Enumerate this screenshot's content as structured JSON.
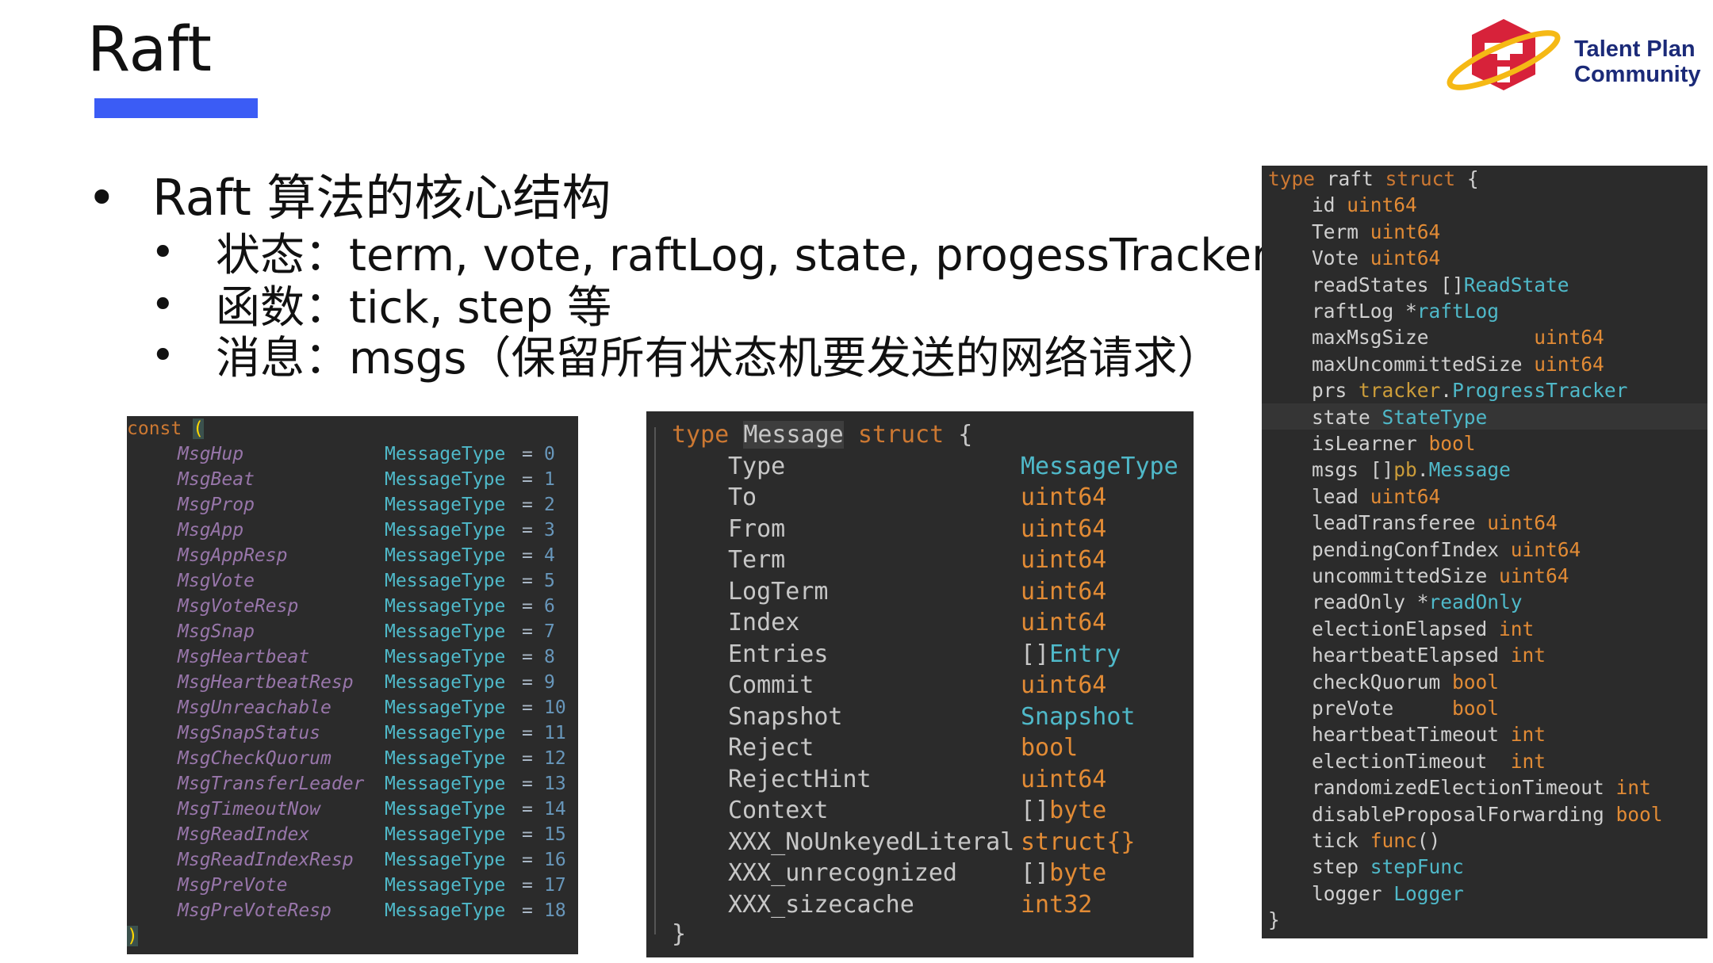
{
  "slide": {
    "title": "Raft",
    "accent_color": "#3b5cf5"
  },
  "logo": {
    "line1": "Talent Plan",
    "line2": "Community",
    "icon": "talent-plan-logo-icon"
  },
  "bullets": {
    "main": "Raft 算法的核心结构",
    "sub": [
      "状态：term, vote, raftLog, state, progessTracker 等",
      "函数：tick, step 等",
      "消息：msgs（保留所有状态机要发送的网络请求）"
    ]
  },
  "code_const": {
    "open_keyword": "const",
    "open_paren": "(",
    "close_paren": ")",
    "type_name": "MessageType",
    "entries": [
      {
        "name": "MsgHup",
        "value": "0"
      },
      {
        "name": "MsgBeat",
        "value": "1"
      },
      {
        "name": "MsgProp",
        "value": "2"
      },
      {
        "name": "MsgApp",
        "value": "3"
      },
      {
        "name": "MsgAppResp",
        "value": "4"
      },
      {
        "name": "MsgVote",
        "value": "5"
      },
      {
        "name": "MsgVoteResp",
        "value": "6"
      },
      {
        "name": "MsgSnap",
        "value": "7"
      },
      {
        "name": "MsgHeartbeat",
        "value": "8"
      },
      {
        "name": "MsgHeartbeatResp",
        "value": "9"
      },
      {
        "name": "MsgUnreachable",
        "value": "10"
      },
      {
        "name": "MsgSnapStatus",
        "value": "11"
      },
      {
        "name": "MsgCheckQuorum",
        "value": "12"
      },
      {
        "name": "MsgTransferLeader",
        "value": "13"
      },
      {
        "name": "MsgTimeoutNow",
        "value": "14"
      },
      {
        "name": "MsgReadIndex",
        "value": "15"
      },
      {
        "name": "MsgReadIndexResp",
        "value": "16"
      },
      {
        "name": "MsgPreVote",
        "value": "17"
      },
      {
        "name": "MsgPreVoteResp",
        "value": "18"
      }
    ]
  },
  "code_message": {
    "kw_type": "type",
    "name": "Message",
    "kw_struct": "struct",
    "open_brace": "{",
    "close_brace": "}",
    "fields": [
      {
        "name": "Type",
        "type": "MessageType"
      },
      {
        "name": "To",
        "type": "uint64"
      },
      {
        "name": "From",
        "type": "uint64"
      },
      {
        "name": "Term",
        "type": "uint64"
      },
      {
        "name": "LogTerm",
        "type": "uint64"
      },
      {
        "name": "Index",
        "type": "uint64"
      },
      {
        "name": "Entries",
        "type_prefix": "[]",
        "type": "Entry"
      },
      {
        "name": "Commit",
        "type": "uint64"
      },
      {
        "name": "Snapshot",
        "type": "Snapshot"
      },
      {
        "name": "Reject",
        "type": "bool"
      },
      {
        "name": "RejectHint",
        "type": "uint64"
      },
      {
        "name": "Context",
        "type_prefix": "[]",
        "type": "byte"
      },
      {
        "name": "XXX_NoUnkeyedLiteral",
        "type": "struct{}"
      },
      {
        "name": "XXX_unrecognized",
        "type_prefix": "[]",
        "type": "byte"
      },
      {
        "name": "XXX_sizecache",
        "type": "int32"
      }
    ]
  },
  "code_raft": {
    "kw_type": "type",
    "name": "raft",
    "kw_struct": "struct",
    "open_brace": "{",
    "close_brace": "}",
    "fields": [
      {
        "name": "id",
        "sep": " ",
        "pre": "",
        "type": "uint64",
        "kind": "builtin"
      },
      {
        "name": "Term",
        "sep": " ",
        "pre": "",
        "type": "uint64",
        "kind": "builtin"
      },
      {
        "name": "Vote",
        "sep": " ",
        "pre": "",
        "type": "uint64",
        "kind": "builtin"
      },
      {
        "name": "readStates",
        "sep": " ",
        "pre": "[]",
        "type": "ReadState",
        "kind": "ref"
      },
      {
        "name": "raftLog",
        "sep": " ",
        "pre": "*",
        "type": "raftLog",
        "kind": "ref"
      },
      {
        "name": "maxMsgSize",
        "sep": "         ",
        "pre": "",
        "type": "uint64",
        "kind": "builtin"
      },
      {
        "name": "maxUncommittedSize",
        "sep": " ",
        "pre": "",
        "type": "uint64",
        "kind": "builtin"
      },
      {
        "name": "prs",
        "sep": " ",
        "pre": "",
        "pkg": "tracker",
        "type": "ProgressTracker",
        "kind": "ref"
      },
      {
        "name": "state",
        "sep": " ",
        "pre": "",
        "type": "StateType",
        "kind": "ref"
      },
      {
        "name": "isLearner",
        "sep": " ",
        "pre": "",
        "type": "bool",
        "kind": "builtin"
      },
      {
        "name": "msgs",
        "sep": " ",
        "pre": "[]",
        "pkg": "pb",
        "type": "Message",
        "kind": "ref"
      },
      {
        "name": "lead",
        "sep": " ",
        "pre": "",
        "type": "uint64",
        "kind": "builtin"
      },
      {
        "name": "leadTransferee",
        "sep": " ",
        "pre": "",
        "type": "uint64",
        "kind": "builtin"
      },
      {
        "name": "pendingConfIndex",
        "sep": " ",
        "pre": "",
        "type": "uint64",
        "kind": "builtin"
      },
      {
        "name": "uncommittedSize",
        "sep": " ",
        "pre": "",
        "type": "uint64",
        "kind": "builtin"
      },
      {
        "name": "readOnly",
        "sep": " ",
        "pre": "*",
        "type": "readOnly",
        "kind": "ref"
      },
      {
        "name": "electionElapsed",
        "sep": " ",
        "pre": "",
        "type": "int",
        "kind": "builtin"
      },
      {
        "name": "heartbeatElapsed",
        "sep": " ",
        "pre": "",
        "type": "int",
        "kind": "builtin"
      },
      {
        "name": "checkQuorum",
        "sep": " ",
        "pre": "",
        "type": "bool",
        "kind": "builtin"
      },
      {
        "name": "preVote",
        "sep": "     ",
        "pre": "",
        "type": "bool",
        "kind": "builtin"
      },
      {
        "name": "heartbeatTimeout",
        "sep": " ",
        "pre": "",
        "type": "int",
        "kind": "builtin"
      },
      {
        "name": "electionTimeout",
        "sep": "  ",
        "pre": "",
        "type": "int",
        "kind": "builtin"
      },
      {
        "name": "randomizedElectionTimeout",
        "sep": " ",
        "pre": "",
        "type": "int",
        "kind": "builtin"
      },
      {
        "name": "disableProposalForwarding",
        "sep": " ",
        "pre": "",
        "type": "bool",
        "kind": "builtin"
      },
      {
        "name": "tick",
        "sep": " ",
        "pre": "",
        "type": "func",
        "suffix": "()",
        "kind": "builtin"
      },
      {
        "name": "step",
        "sep": " ",
        "pre": "",
        "type": "stepFunc",
        "kind": "ref"
      },
      {
        "name": "logger",
        "sep": " ",
        "pre": "",
        "type": "Logger",
        "kind": "ref"
      }
    ]
  }
}
